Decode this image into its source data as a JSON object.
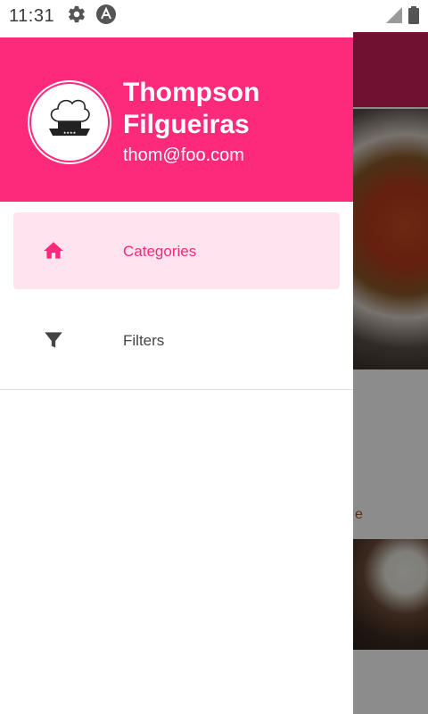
{
  "status_bar": {
    "time": "11:31",
    "icons_left": [
      "gear-icon",
      "app-logo-icon"
    ],
    "icons_right": [
      "signal-icon",
      "battery-icon"
    ]
  },
  "drawer": {
    "header": {
      "user_name": "Thompson Filgueiras",
      "email": "thom@foo.com",
      "avatar_icon": "chef-hat-icon"
    },
    "items": [
      {
        "label": "Categories",
        "icon": "home-icon",
        "active": true
      },
      {
        "label": "Filters",
        "icon": "filter-icon",
        "active": false
      }
    ]
  },
  "colors": {
    "primary": "#fd2a7b",
    "active_item_bg": "#ffe3ef",
    "background_appbar": "#cc1f5a"
  },
  "background_app": {
    "partial_text": "e"
  }
}
